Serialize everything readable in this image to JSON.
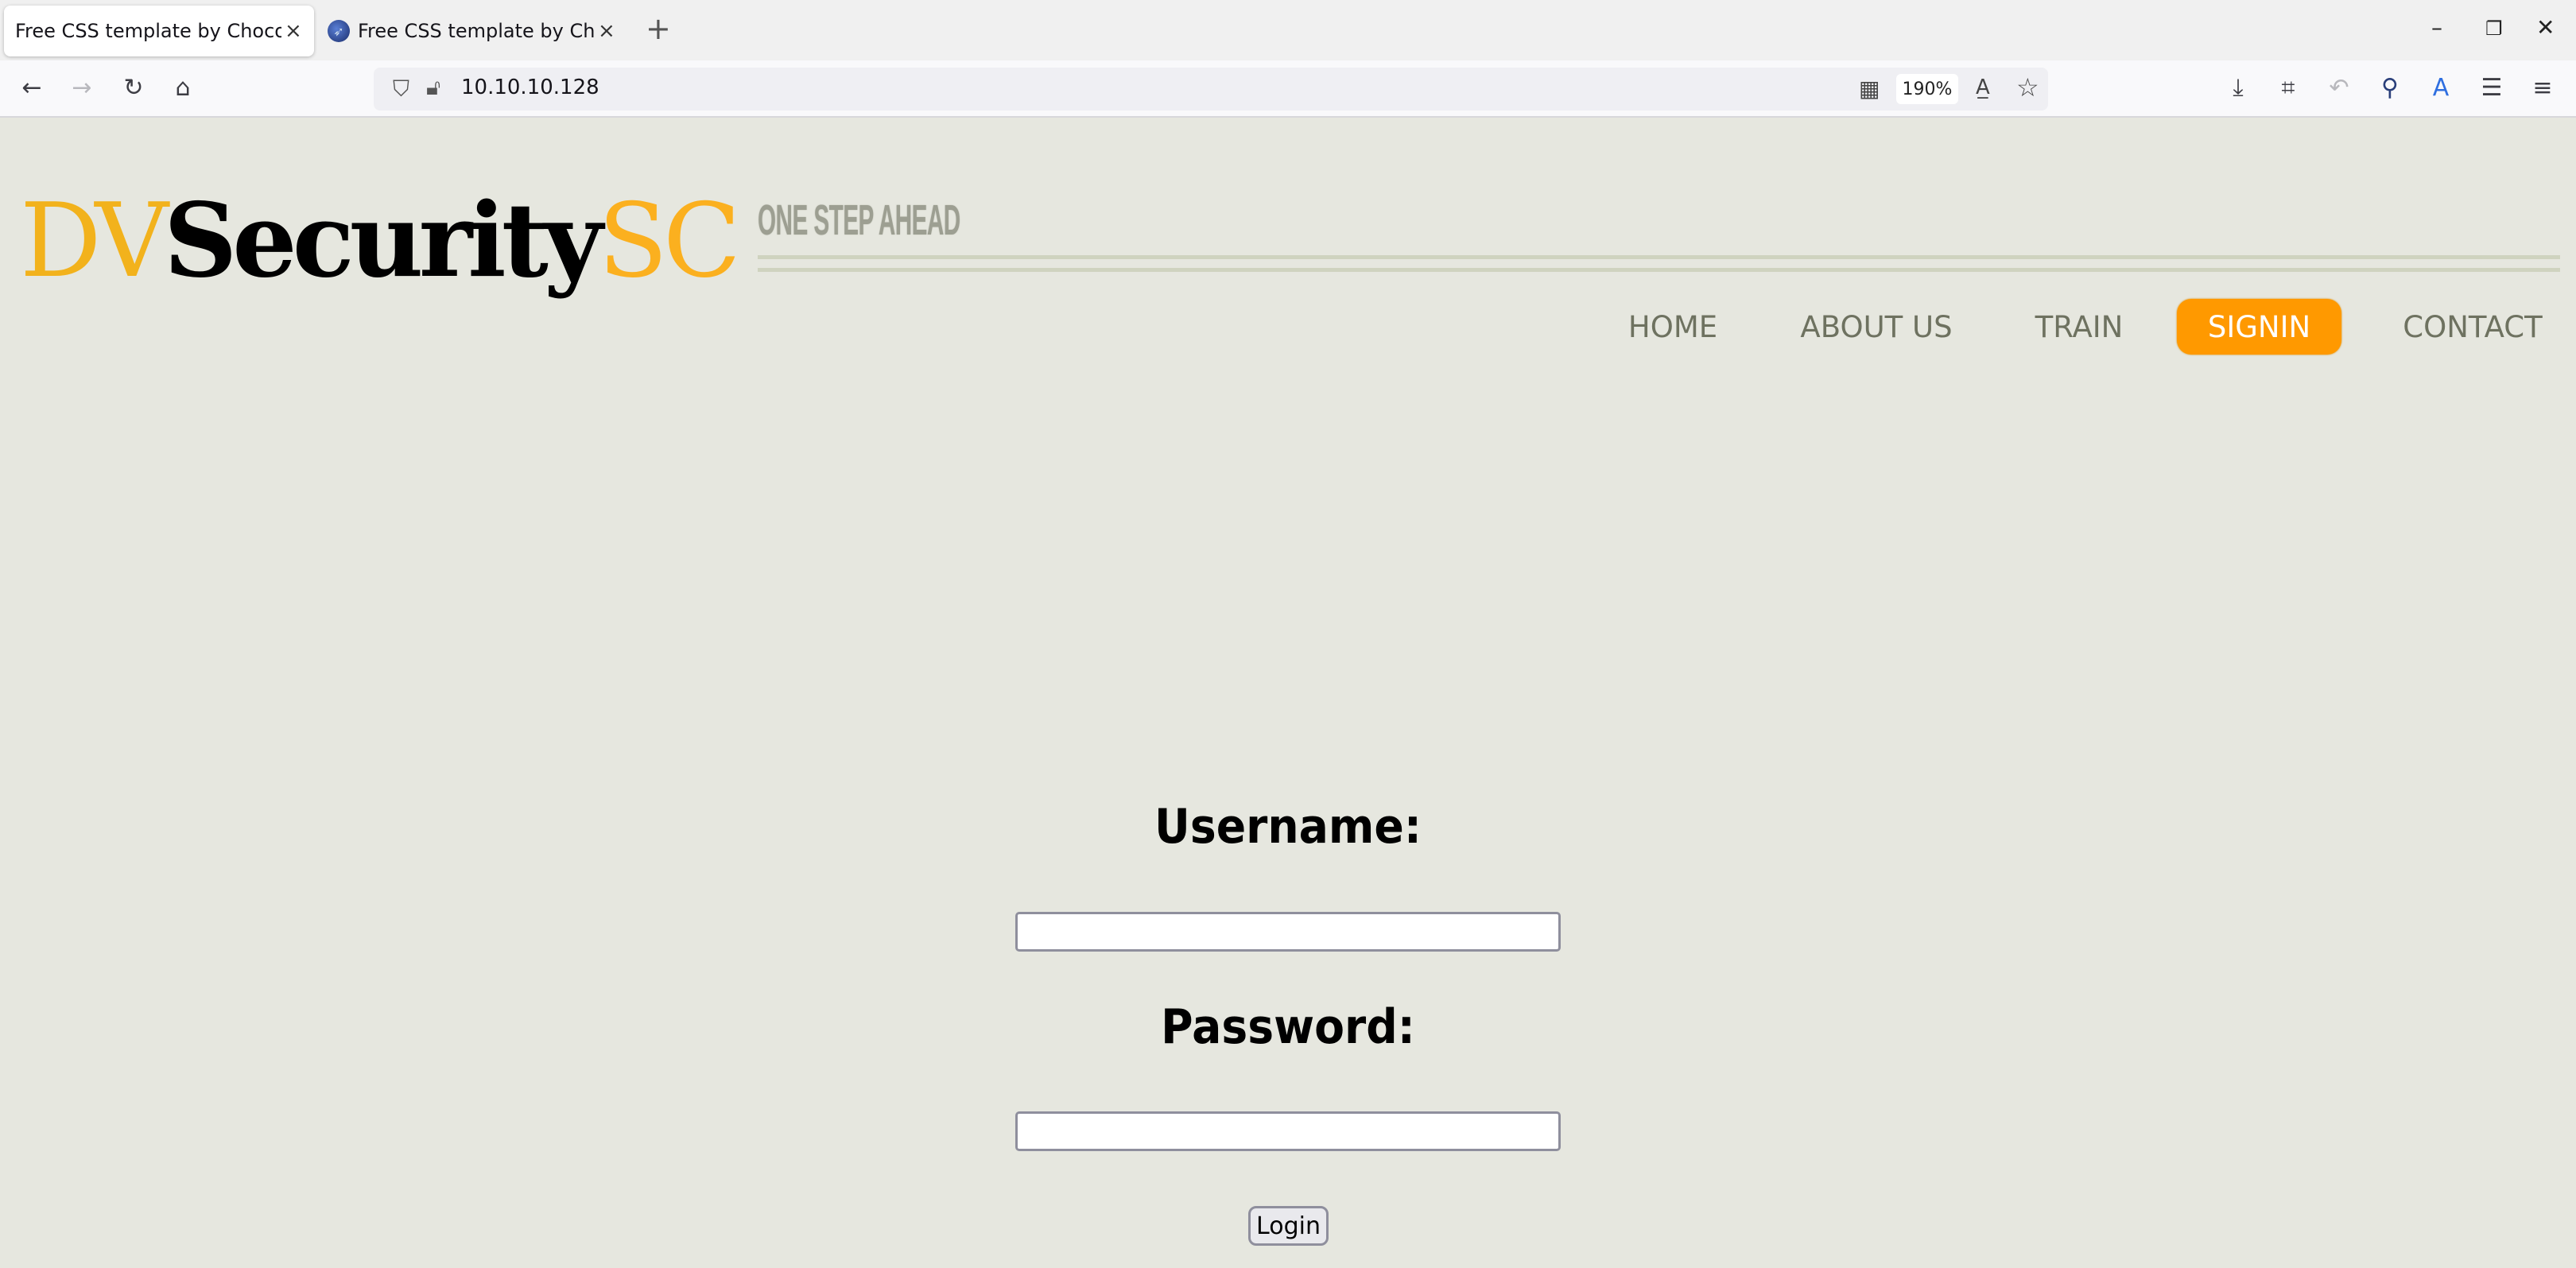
{
  "browser": {
    "tabs": [
      {
        "title": "Free CSS template by ChocoTemp",
        "active": true
      },
      {
        "title": "Free CSS template by ChocoTe",
        "active": false
      }
    ],
    "new_tab_icon": "+",
    "close_icon": "×",
    "window_controls": {
      "minimize": "–",
      "restore": "❐",
      "close": "✕"
    },
    "nav_icons": {
      "back": "←",
      "forward": "→",
      "reload": "↻",
      "home": "⌂"
    },
    "url": "10.10.10.128",
    "zoom_level": "190%",
    "toolbar_icons": [
      "download-icon",
      "crop-icon",
      "undo-icon",
      "extension-icon",
      "translate-icon",
      "server-icon",
      "menu-icon"
    ]
  },
  "site": {
    "logo": {
      "part1": "DV",
      "part2": "Security",
      "part3": "SC"
    },
    "tagline": "ONE STEP AHEAD",
    "nav": [
      {
        "label": "HOME",
        "active": false
      },
      {
        "label": "ABOUT US",
        "active": false
      },
      {
        "label": "TRAIN",
        "active": false
      },
      {
        "label": "SIGNIN",
        "active": true
      },
      {
        "label": "CONTACT",
        "active": false
      }
    ],
    "colors": {
      "background": "#e6e7df",
      "accent": "#ff9900",
      "logo_yellow": "#f2b21c",
      "nav_text": "#6e7260"
    }
  },
  "login_form": {
    "username_label": "Username:",
    "username_value": "",
    "password_label": "Password:",
    "password_value": "",
    "submit_label": "Login"
  }
}
